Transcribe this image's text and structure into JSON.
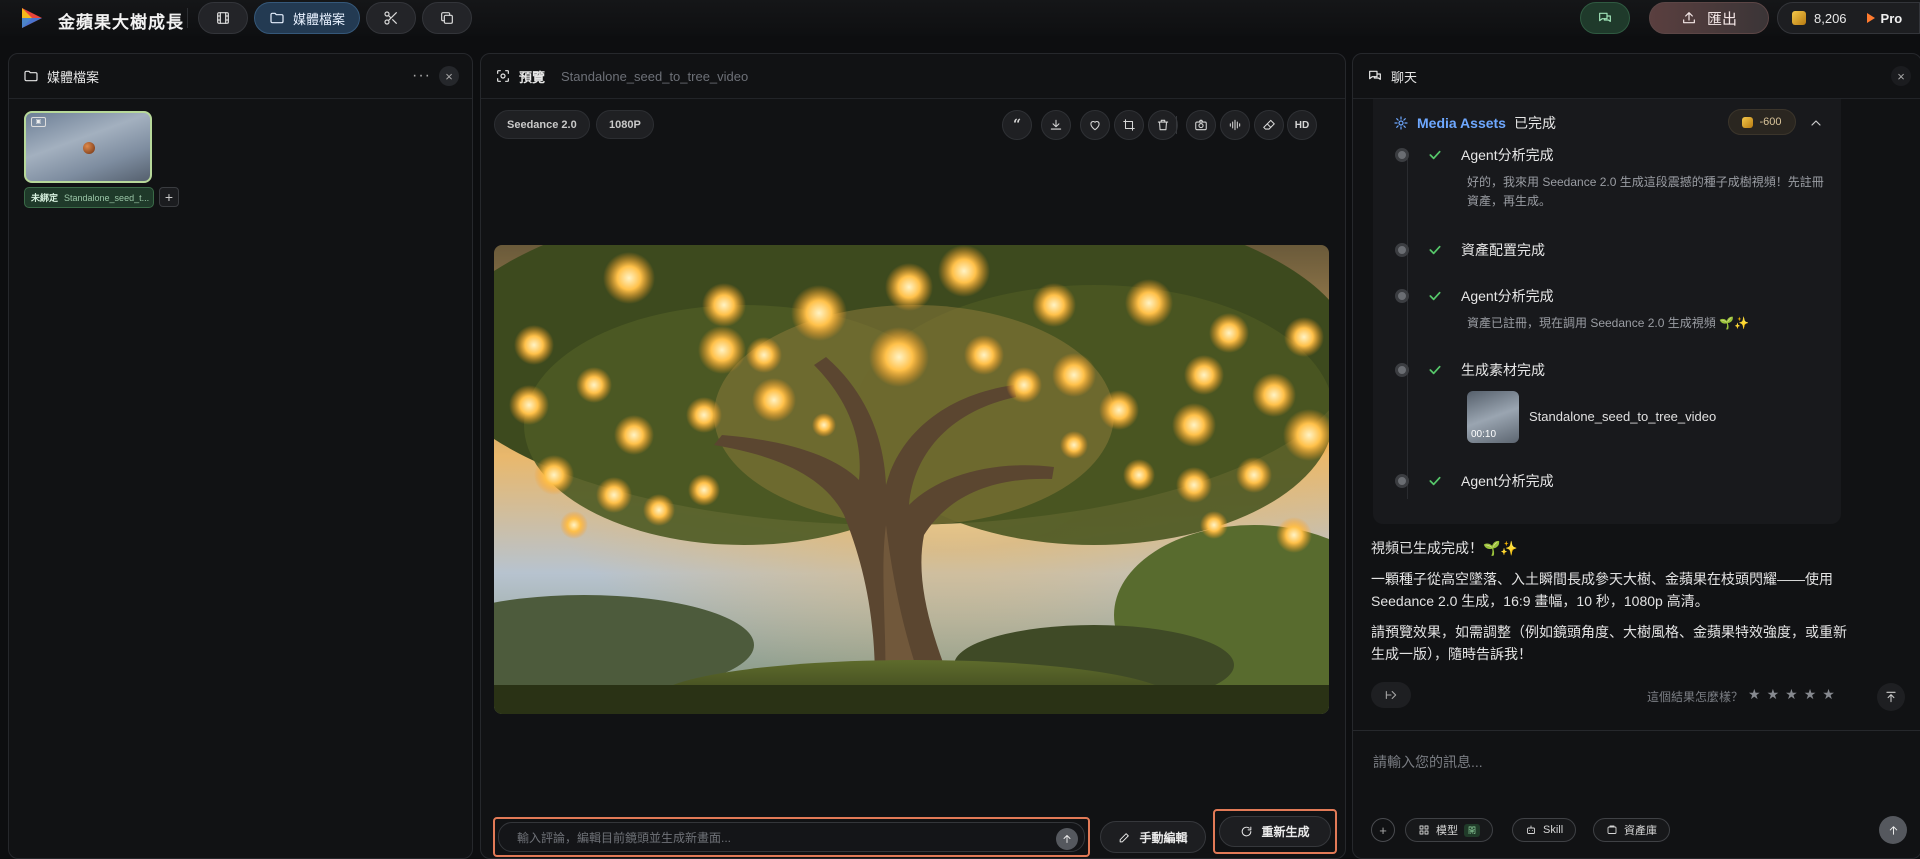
{
  "app": {
    "title": "金蘋果大樹成長"
  },
  "toolbar": {
    "media_label": "媒體檔案",
    "export_label": "匯出",
    "credits": "8,206",
    "plan": "Pro"
  },
  "media_panel": {
    "title": "媒體檔案",
    "item": {
      "status": "未綁定",
      "name": "Standalone_seed_t..."
    }
  },
  "preview_panel": {
    "title": "預覽",
    "file_name": "Standalone_seed_to_tree_video",
    "model": "Seedance 2.0",
    "resolution": "1080P",
    "hd_label": "HD",
    "comment_placeholder": "輸入評論，編輯目前鏡頭並生成新畫面...",
    "manual_edit_label": "手動編輯",
    "regenerate_label": "重新生成"
  },
  "chat_panel": {
    "title": "聊天",
    "assets_card": {
      "title": "Media Assets",
      "status": "已完成",
      "cost": "-600",
      "steps": [
        {
          "label": "Agent分析完成",
          "desc": "好的，我來用 Seedance 2.0 生成這段震撼的種子成樹視頻！先註冊資產，再生成。"
        },
        {
          "label": "資產配置完成"
        },
        {
          "label": "Agent分析完成",
          "desc": "資產已註冊，現在調用 Seedance 2.0 生成視頻 🌱✨"
        },
        {
          "label": "生成素材完成",
          "asset_name": "Standalone_seed_to_tree_video",
          "duration": "00:10"
        },
        {
          "label": "Agent分析完成"
        }
      ]
    },
    "messages": [
      "視頻已生成完成！🌱✨",
      "一顆種子從高空墜落、入土瞬間長成參天大樹、金蘋果在枝頭閃耀——使用 Seedance 2.0 生成，16:9 畫幅，10 秒，1080p 高清。",
      "請預覽效果，如需調整（例如鏡頭角度、大樹風格、金蘋果特效強度，或重新生成一版），隨時告訴我！"
    ],
    "rating_prompt": "這個結果怎麼樣？",
    "input_placeholder": "請輸入您的訊息...",
    "chips": {
      "model": "模型",
      "model_state": "開",
      "skill": "Skill",
      "library": "資產庫"
    }
  },
  "colors": {
    "accent_green": "#56c76a",
    "highlight_orange": "#e27a57",
    "link_blue": "#6ea8ff"
  },
  "icons": [
    "film-icon",
    "folder-icon",
    "scissors-icon",
    "copy-icon",
    "chat-icon",
    "upload-icon",
    "coin-icon",
    "scan-icon",
    "quote-icon",
    "download-icon",
    "heart-icon",
    "crop-icon",
    "trash-icon",
    "camera-icon",
    "waveform-icon",
    "eraser-icon",
    "cube-icon",
    "check-icon",
    "share-icon",
    "arrow-up-icon",
    "plus-icon",
    "grid-icon",
    "robot-icon",
    "library-icon",
    "edit-icon",
    "refresh-icon",
    "close-icon",
    "more-icon",
    "chevron-up-icon"
  ]
}
